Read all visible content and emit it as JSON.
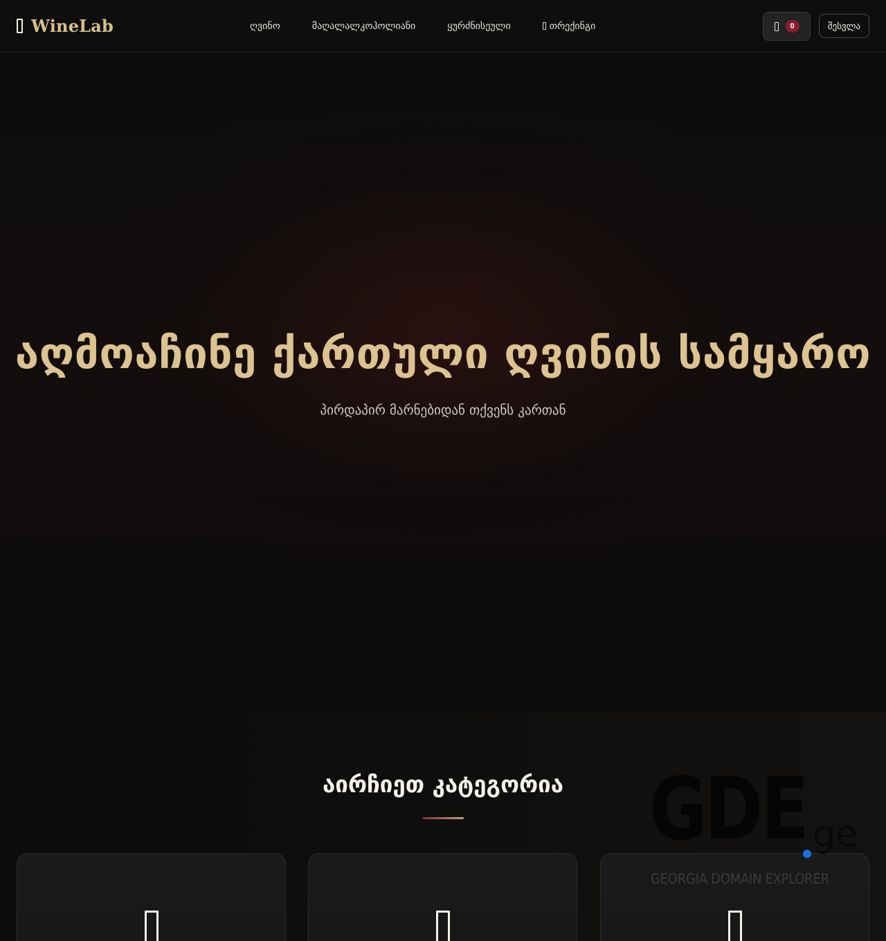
{
  "navbar": {
    "brand": {
      "icon": "wine-glass-icon",
      "name": "WineLab"
    },
    "links": [
      {
        "label": "ღვინო"
      },
      {
        "label": "მაღალალკოჰოლიანი"
      },
      {
        "label": "ყურძნისეული"
      },
      {
        "label": "თრექინგი",
        "icon": "map-icon"
      }
    ],
    "cart": {
      "icon": "cart-icon",
      "count": "0"
    },
    "login_label": "შესვლა"
  },
  "hero": {
    "title": "აღმოაჩინე ქართული ღვინის სამყარო",
    "subtitle": "პირდაპირ მარნებიდან თქვენს კართან"
  },
  "categories": {
    "title": "აირჩიეთ კატეგორია",
    "cards": [
      {
        "icon": "wine-bottle-icon"
      },
      {
        "icon": "liquor-glass-icon"
      },
      {
        "icon": "grapes-icon"
      }
    ]
  },
  "watermark": {
    "letters": "GDE",
    "tld": "ge",
    "tagline": "GEORGIA DOMAIN EXPLORER",
    "dot_color": "#1f6fe0"
  },
  "colors": {
    "accent_gold": "#dcc38f",
    "badge_red": "#8c1f2e",
    "background": "#0c0c0c"
  }
}
